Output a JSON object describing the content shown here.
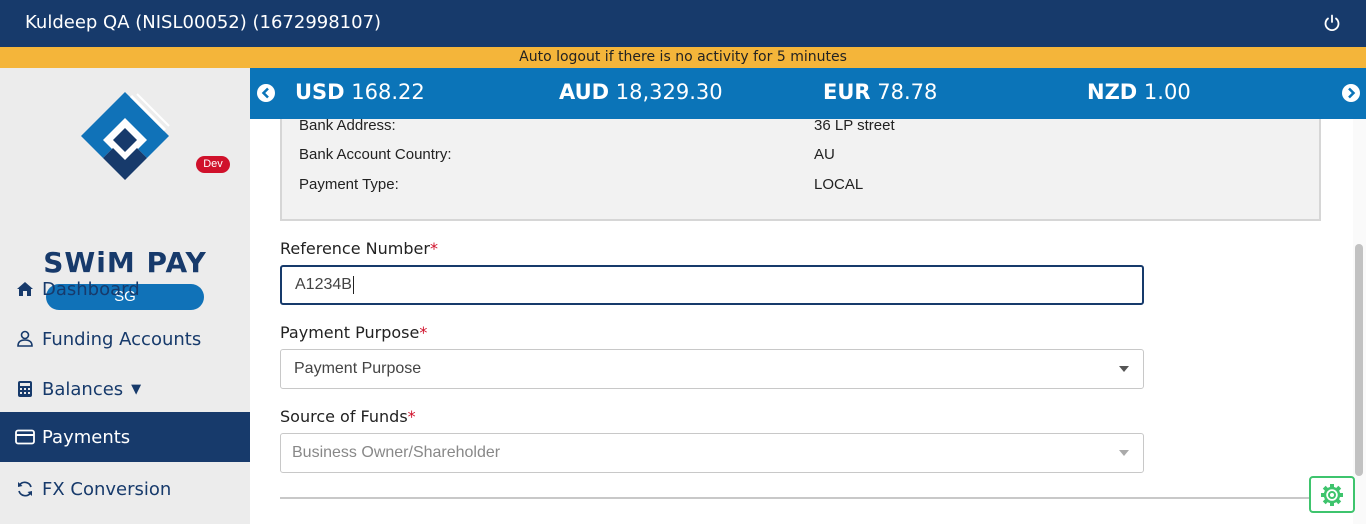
{
  "header": {
    "user_label": "Kuldeep QA (NISL00052) (1672998107)",
    "power_icon": "power-icon"
  },
  "notice": "Auto logout if there is no activity for 5 minutes",
  "sidebar": {
    "badge": "Dev",
    "brand": "SWiM PAY",
    "region": "SG",
    "items": [
      {
        "label": "Dashboard",
        "icon": "home-icon"
      },
      {
        "label": "Funding Accounts",
        "icon": "user-icon"
      },
      {
        "label": "Balances",
        "icon": "calculator-icon"
      },
      {
        "label": "Payments",
        "icon": "card-icon"
      },
      {
        "label": "FX Conversion",
        "icon": "refresh-icon"
      }
    ]
  },
  "rates": [
    {
      "currency": "USD",
      "value": "168.22"
    },
    {
      "currency": "AUD",
      "value": "18,329.30"
    },
    {
      "currency": "EUR",
      "value": "78.78"
    },
    {
      "currency": "NZD",
      "value": "1.00"
    }
  ],
  "details": [
    {
      "label": "Bank Address:",
      "value": "36 LP street"
    },
    {
      "label": "Bank Account Country:",
      "value": "AU"
    },
    {
      "label": "Payment Type:",
      "value": "LOCAL"
    }
  ],
  "form": {
    "reference": {
      "label": "Reference Number",
      "required": "*",
      "value": "A1234B"
    },
    "purpose": {
      "label": "Payment Purpose",
      "required": "*",
      "value": "Payment Purpose"
    },
    "source": {
      "label": "Source of Funds",
      "required": "*",
      "value": "Business Owner/Shareholder"
    }
  },
  "colors": {
    "primary": "#173a6b",
    "rate_bar": "#0b74b8",
    "notice": "#f4b53a",
    "badge": "#d0112b",
    "settings": "#3ec46d"
  }
}
